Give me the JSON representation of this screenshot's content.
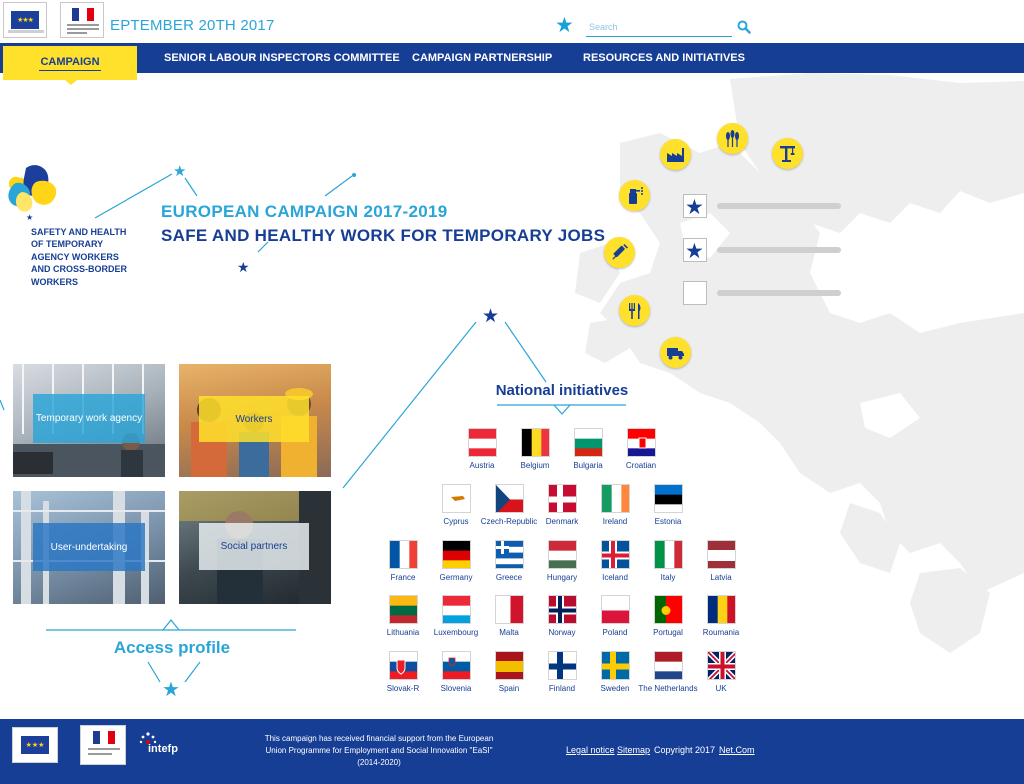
{
  "header": {
    "date_text": "EPTEMBER 20TH 2017",
    "search_placeholder": "Search",
    "eu_logo_text": "Commission européenne",
    "fr_logo_text": "Ministère du Travail"
  },
  "nav": {
    "items": [
      {
        "label": "CAMPAIGN",
        "active": true
      },
      {
        "label": "SENIOR LABOUR INSPECTORS COMMITTEE",
        "active": false
      },
      {
        "label": "CAMPAIGN PARTNERSHIP",
        "active": false
      },
      {
        "label": "RESOURCES AND INITIATIVES",
        "active": false
      }
    ]
  },
  "campaign": {
    "logo_text": "SAFETY AND HEALTH OF TEMPORARY AGENCY WORKERS AND CROSS-BORDER WORKERS",
    "title_line1": "EUROPEAN CAMPAIGN 2017-2019",
    "title_line2": "SAFE AND HEALTHY WORK FOR TEMPORARY JOBS"
  },
  "profiles": {
    "title": "Access profile",
    "tiles": [
      {
        "label": "Temporary work agency"
      },
      {
        "label": "Workers"
      },
      {
        "label": "User-undertaking"
      },
      {
        "label": "Social partners"
      }
    ]
  },
  "national": {
    "title": "National initiatives",
    "countries": [
      "Austria",
      "Belgium",
      "Bulgaria",
      "Croatian",
      "Cyprus",
      "Czech-Republic",
      "Denmark",
      "Ireland",
      "Estonia",
      "France",
      "Germany",
      "Greece",
      "Hungary",
      "Iceland",
      "Italy",
      "Latvia",
      "Lithuania",
      "Luxembourg",
      "Malta",
      "Norway",
      "Poland",
      "Portugal",
      "Roumania",
      "Slovak-R",
      "Slovenia",
      "Spain",
      "Finland",
      "Sweden",
      "The Netherlands",
      "UK"
    ]
  },
  "map_panel": {
    "badge_icons": [
      "factory-icon",
      "wheat-icon",
      "crane-icon",
      "cleaning-spray-icon",
      "syringe-icon",
      "cutlery-icon",
      "truck-icon"
    ],
    "checklist": [
      {
        "checked": true
      },
      {
        "checked": true
      },
      {
        "checked": false
      }
    ]
  },
  "footer": {
    "funding_line1": "This campaign has received financial support from the European",
    "funding_line2": "Union Programme for Employment and Social Innovation \"EaSI\"",
    "funding_line3": "(2014-2020)",
    "intefp_label": "intefp",
    "legal_notice": "Legal notice",
    "sitemap": "Sitemap",
    "copyright": "Copyright 2017",
    "netcom": "Net.Com",
    "separator": "·"
  },
  "colors": {
    "navy": "#173e95",
    "cyan": "#2aa5d8",
    "yellow": "#ffe02b"
  }
}
